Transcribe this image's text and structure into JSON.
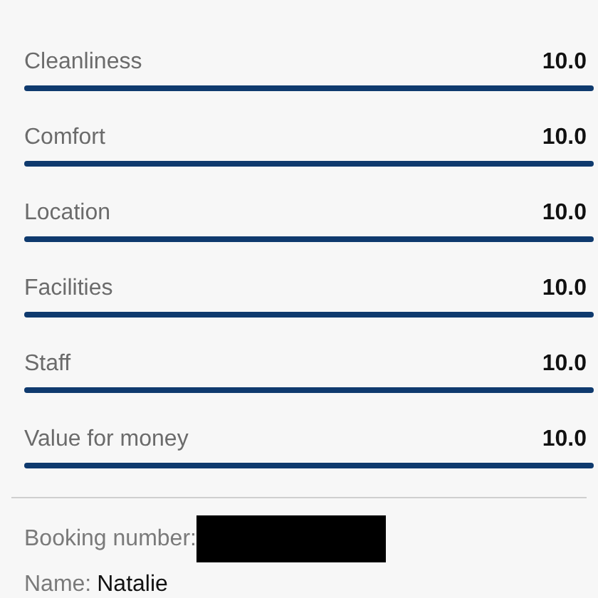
{
  "ratings": [
    {
      "label": "Cleanliness",
      "score": "10.0",
      "level": 1
    },
    {
      "label": "Comfort",
      "score": "10.0",
      "level": 1
    },
    {
      "label": "Location",
      "score": "10.0",
      "level": 1
    },
    {
      "label": "Facilities",
      "score": "10.0",
      "level": 1
    },
    {
      "label": "Staff",
      "score": "10.0",
      "level": 1
    },
    {
      "label": "Value for money",
      "score": "10.0",
      "level": 1
    }
  ],
  "booking": {
    "number_label": "Booking number:",
    "name_label": "Name:",
    "name": "Natalie"
  }
}
